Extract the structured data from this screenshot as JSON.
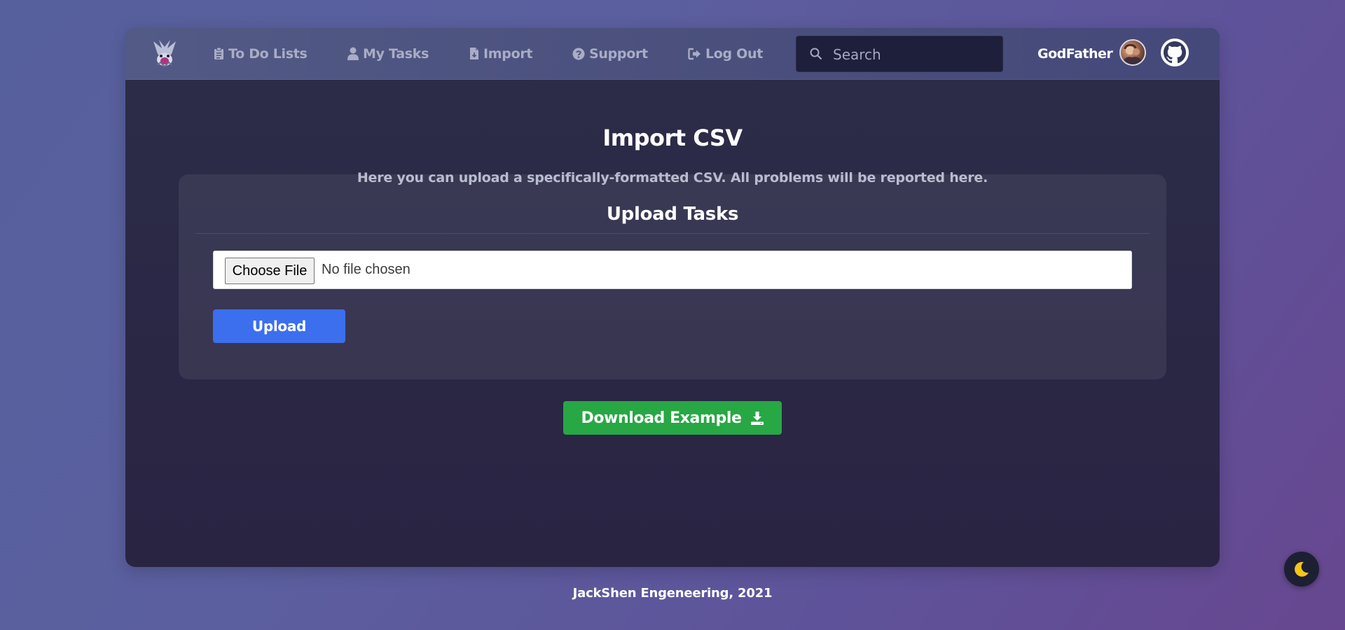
{
  "navbar": {
    "items": [
      {
        "label": "To Do Lists",
        "icon": "clipboard-icon"
      },
      {
        "label": "My Tasks",
        "icon": "user-icon"
      },
      {
        "label": "Import",
        "icon": "file-import-icon"
      },
      {
        "label": "Support",
        "icon": "question-circle-icon"
      },
      {
        "label": "Log Out",
        "icon": "sign-out-icon"
      }
    ],
    "search_placeholder": "Search",
    "username": "GodFather"
  },
  "main": {
    "title": "Import CSV",
    "subtitle": "Here you can upload a specifically-formatted CSV. All problems will be reported here."
  },
  "upload_panel": {
    "title": "Upload Tasks",
    "choose_file_label": "Choose File",
    "file_status": "No file chosen",
    "upload_label": "Upload"
  },
  "download_example_label": "Download Example",
  "footer": {
    "text": "JackShen Engeneering, 2021"
  },
  "colors": {
    "upload_button": "#3b6fee",
    "download_button": "#28a745",
    "moon_icon": "#f5c518"
  },
  "icons": [
    "logo-icon",
    "search-icon",
    "avatar",
    "github-icon",
    "download-icon",
    "moon-icon"
  ]
}
